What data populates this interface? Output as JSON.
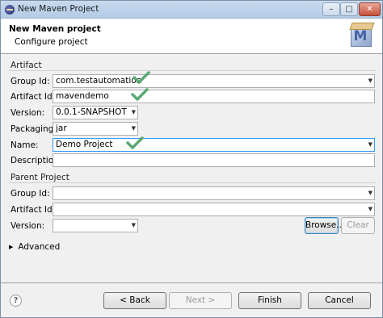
{
  "window": {
    "title": "New Maven Project"
  },
  "header": {
    "title": "New Maven project",
    "description": "Configure project",
    "logo_letter": "M"
  },
  "artifact": {
    "section_label": "Artifact",
    "group_id": {
      "label": "Group Id:",
      "value": "com.testautomation"
    },
    "artifact_id": {
      "label": "Artifact Id:",
      "value": "mavendemo"
    },
    "version": {
      "label": "Version:",
      "value": "0.0.1-SNAPSHOT"
    },
    "packaging": {
      "label": "Packaging:",
      "value": "jar"
    },
    "name": {
      "label": "Name:",
      "value": "Demo Project"
    },
    "description": {
      "label": "Description:",
      "value": ""
    }
  },
  "parent": {
    "section_label": "Parent Project",
    "group_id": {
      "label": "Group Id:",
      "value": ""
    },
    "artifact_id": {
      "label": "Artifact Id:",
      "value": ""
    },
    "version": {
      "label": "Version:",
      "value": ""
    },
    "browse_label": "Browse...",
    "clear_label": "Clear"
  },
  "advanced": {
    "label": "Advanced"
  },
  "footer": {
    "back_label": "< Back",
    "next_label": "Next >",
    "finish_label": "Finish",
    "cancel_label": "Cancel",
    "help_symbol": "?"
  },
  "colors": {
    "checkmark": "#5aa873",
    "focus_border": "#3399ff",
    "title_bar": "#c8daee"
  },
  "icons": {
    "dropdown": "down-triangle",
    "checkmark": "check-icon",
    "expand": "right-triangle",
    "help": "help-icon"
  }
}
